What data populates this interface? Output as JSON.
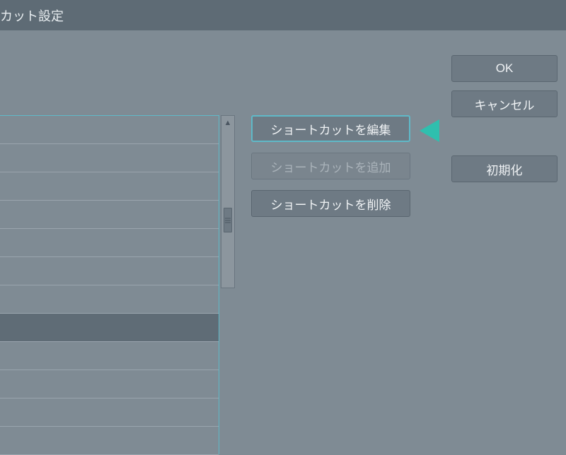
{
  "titlebar": {
    "title": "カット設定"
  },
  "center_buttons": {
    "edit_shortcut": "ショートカットを編集",
    "add_shortcut": "ショートカットを追加",
    "delete_shortcut": "ショートカットを削除"
  },
  "right_buttons": {
    "ok": "OK",
    "cancel": "キャンセル",
    "reset": "初期化"
  }
}
